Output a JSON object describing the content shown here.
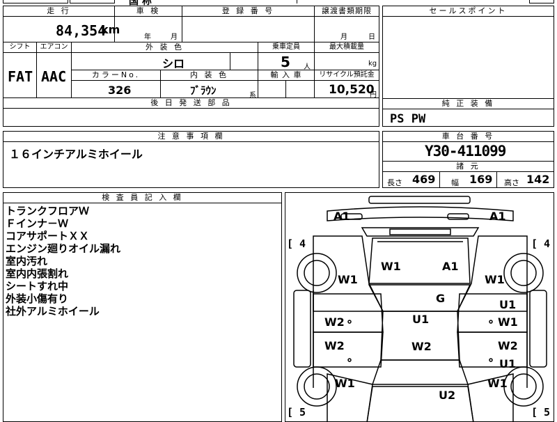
{
  "top_strip": {
    "partial_text": "国 称"
  },
  "labels": {
    "mileage": "走 行",
    "inspection": "車 検",
    "registration": "登 録 番 号",
    "transfer_deadline": "譲渡書類期限",
    "sales_point": "セールスポイント",
    "shift": "シフト",
    "aircon": "エアコン",
    "exterior_color": "外 装 色",
    "capacity": "乗車定員",
    "max_load": "最大積載量",
    "color_no": "カラーNo.",
    "interior_color": "内 装 色",
    "import": "輸 入 車",
    "recycle": "リサイクル預託金",
    "followup_parts": "後 日 発 送 部 品",
    "genuine_equipment": "純 正 装 備",
    "caution": "注 意 事 項 欄",
    "chassis_no": "車 台 番 号",
    "specs": "諸 元",
    "inspector_notes": "検 査 員 記 入 欄"
  },
  "values": {
    "mileage": "84,354",
    "mileage_unit": "km",
    "inspection_year": "年",
    "inspection_month": "月",
    "transfer_month": "月",
    "transfer_day": "日",
    "shift": "FAT",
    "aircon": "AAC",
    "exterior_color": "シロ",
    "capacity": "5",
    "capacity_unit": "人",
    "max_load_unit": "kg",
    "color_no": "326",
    "interior_color": "ﾌﾞﾗｳﾝ",
    "interior_suffix": "系",
    "recycle": "10,520",
    "recycle_unit": "円",
    "genuine_equipment": "PS PW",
    "caution": "１６インチアルミホイール",
    "chassis_no": "Y30-411099",
    "length_label": "長さ",
    "length": "469",
    "width_label": "幅",
    "width": "169",
    "height_label": "高さ",
    "height": "142"
  },
  "inspector_notes": [
    "トランクフロアＷ",
    "Ｆインナ－Ｗ",
    "コアサポートＸＸ",
    "エンジン廻りオイル漏れ",
    "室内汚れ",
    "室内内張割れ",
    "シートすれ中",
    "外装小傷有り",
    "社外アルミホイール"
  ],
  "diagram": {
    "damage_marks": {
      "a1_front_left": "A1",
      "a1_front_right": "A1",
      "w1_hood": "W1",
      "a1_hood": "A1",
      "w1_front_fender_left": "W1",
      "w1_front_fender_right": "W1",
      "g_windshield": "G",
      "u1_roof": "U1",
      "w2_roof": "W2",
      "w2_front_door_left": "W2",
      "w2_rear_door_left": "W2",
      "u1_front_door_right": "U1",
      "w1_front_door_right": "W1",
      "w2_rear_door_right": "W2",
      "u1_rear_door_right": "U1",
      "w1_rear_fender_left": "W1",
      "w1_rear_fender_right": "W1",
      "u2_trunk": "U2"
    },
    "tire_fl": "[ 4",
    "tire_fr": "[ 4",
    "tire_rl": "[ 5",
    "tire_rr": "[ 5"
  }
}
